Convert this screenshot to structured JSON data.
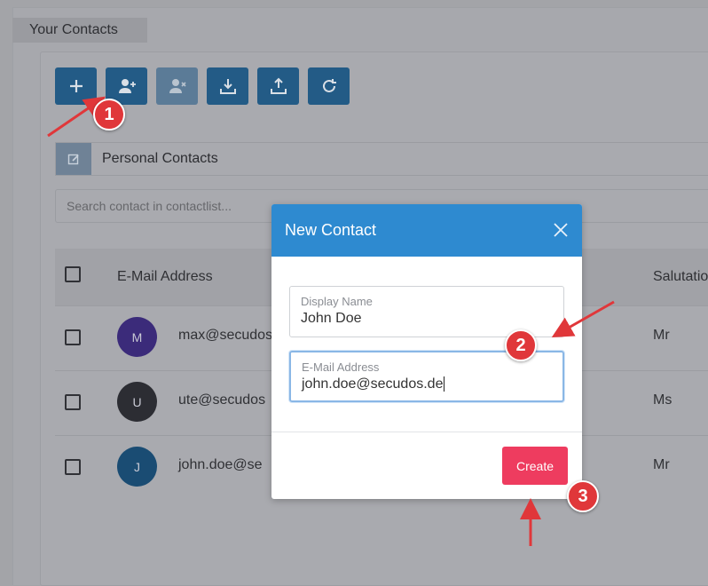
{
  "page": {
    "tab_title": "Your Contacts"
  },
  "toolbar": {
    "buttons": [
      {
        "name": "add",
        "icon": "plus-icon"
      },
      {
        "name": "add-contact",
        "icon": "user-plus-icon"
      },
      {
        "name": "remove-contact",
        "icon": "user-remove-icon",
        "disabled": true
      },
      {
        "name": "import",
        "icon": "download-icon"
      },
      {
        "name": "export",
        "icon": "upload-icon"
      },
      {
        "name": "refresh",
        "icon": "refresh-icon"
      }
    ]
  },
  "contact_list": {
    "name": "Personal Contacts",
    "edit_icon": "edit-icon"
  },
  "search": {
    "placeholder": "Search contact in contactlist..."
  },
  "table": {
    "headers": {
      "email": "E-Mail Address",
      "salutation": "Salutatio"
    },
    "rows": [
      {
        "avatar_letter": "M",
        "avatar_color": "#3b2b7a",
        "email": "max@secudos",
        "salutation": "Mr"
      },
      {
        "avatar_letter": "U",
        "avatar_color": "#2c2d33",
        "email": "ute@secudos",
        "salutation": "Ms"
      },
      {
        "avatar_letter": "J",
        "avatar_color": "#1a4c73",
        "email": "john.doe@se",
        "salutation": "Mr"
      }
    ]
  },
  "modal": {
    "title": "New Contact",
    "display_name": {
      "label": "Display Name",
      "value": "John Doe"
    },
    "email": {
      "label": "E-Mail Address",
      "value": "john.doe@secudos.de"
    },
    "create_label": "Create"
  },
  "annotations": {
    "step1": "1",
    "step2": "2",
    "step3": "3"
  },
  "colors": {
    "header_blue": "#2e8ad0",
    "create_red": "#ee3c5f",
    "toolbar_blue": "#235b86",
    "badge_red": "#e0373a"
  }
}
